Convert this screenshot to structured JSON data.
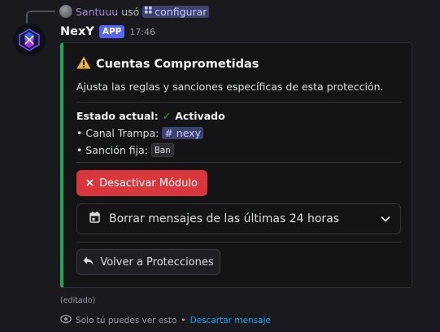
{
  "reply": {
    "username": "Santuuu",
    "action": "usó",
    "command": "configurar"
  },
  "message": {
    "bot_name": "NexY",
    "badge": "APP",
    "timestamp": "17:46",
    "edited_label": "(editado)"
  },
  "embed": {
    "accent_color": "#23a55a",
    "title_icon": "warning-icon",
    "title": "Cuentas Comprometidas",
    "description": "Ajusta las reglas y sanciones específicas de esta protección.",
    "status_label": "Estado actual:",
    "status_value": "Activado",
    "channel_label": "• Canal Trampa:",
    "channel_value": "# nexy",
    "sanction_label": "• Sanción fija:",
    "sanction_value": "Ban"
  },
  "components": {
    "deactivate_button": "Desactivar Módulo",
    "select_value": "Borrar mensajes de las últimas 24 horas",
    "back_button": "Volver a Protecciones"
  },
  "footer": {
    "ephemeral_text": "Solo tú puedes ver esto",
    "separator": "•",
    "dismiss_link": "Descartar mensaje"
  }
}
